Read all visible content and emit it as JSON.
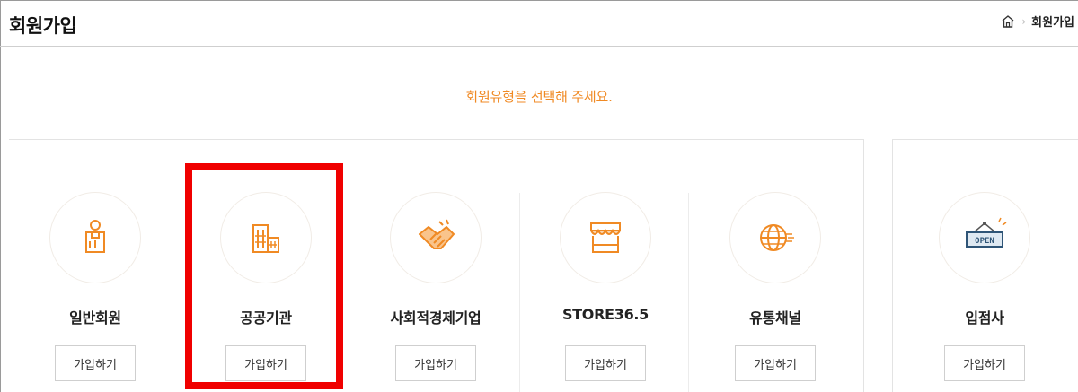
{
  "header": {
    "title": "회원가입",
    "breadcrumb": {
      "home_icon": "home-icon",
      "current": "회원가입"
    }
  },
  "instruction": "회원유형을 선택해 주세요.",
  "accent_color": "#f08a24",
  "highlight_color": "#f00000",
  "member_types": [
    {
      "label": "일반회원",
      "icon": "person-badge-icon",
      "button": "가입하기"
    },
    {
      "label": "공공기관",
      "icon": "building-icon",
      "button": "가입하기"
    },
    {
      "label": "사회적경제기업",
      "icon": "handshake-icon",
      "button": "가입하기"
    },
    {
      "label": "STORE36.5",
      "icon": "storefront-icon",
      "button": "가입하기"
    },
    {
      "label": "유통채널",
      "icon": "globe-network-icon",
      "button": "가입하기"
    },
    {
      "label": "입점사",
      "icon": "open-sign-icon",
      "button": "가입하기"
    }
  ],
  "open_sign_text": "OPEN",
  "highlighted_item": "공공기관"
}
